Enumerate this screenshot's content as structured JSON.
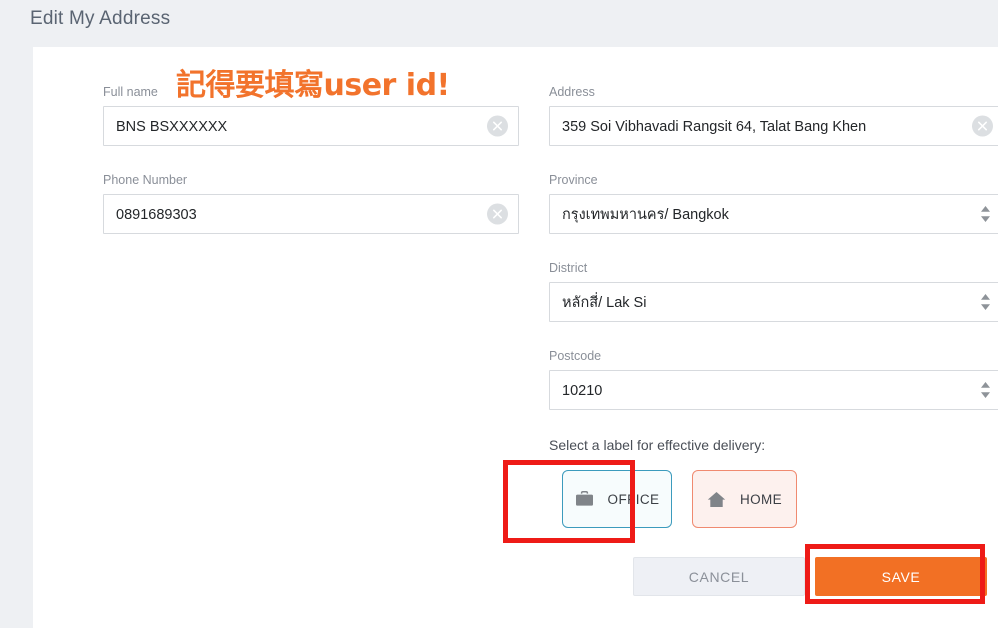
{
  "header": {
    "title": "Edit My Address"
  },
  "form": {
    "fields": [
      {
        "key": "fullname",
        "label": "Full name",
        "value": "BNS BSXXXXXX",
        "type": "text",
        "trailing_icon": "clear-icon"
      },
      {
        "key": "phone",
        "label": "Phone Number",
        "value": "0891689303",
        "type": "text",
        "trailing_icon": "clear-icon"
      },
      {
        "key": "address",
        "label": "Address",
        "value": "359 Soi Vibhavadi Rangsit 64, Talat Bang Khen",
        "type": "text",
        "trailing_icon": "clear-icon"
      },
      {
        "key": "province",
        "label": "Province",
        "value": "กรุงเทพมหานคร/ Bangkok",
        "type": "select",
        "trailing_icon": "updown-spinner-icon"
      },
      {
        "key": "district",
        "label": "District",
        "value": "หลักสี่/ Lak Si",
        "type": "select",
        "trailing_icon": "updown-spinner-icon"
      },
      {
        "key": "postcode",
        "label": "Postcode",
        "value": "10210",
        "type": "select",
        "trailing_icon": "updown-spinner-icon"
      }
    ]
  },
  "label_selector": {
    "hint": "Select a label for effective delivery:",
    "options": [
      {
        "key": "office",
        "label": "OFFICE",
        "icon": "briefcase-icon",
        "selected": true,
        "border_color": "#3c9bbd",
        "background_color": "#f7fcfd"
      },
      {
        "key": "home",
        "label": "HOME",
        "icon": "home-icon",
        "selected": false,
        "border_color": "#f08a70",
        "background_color": "#fdf1ee"
      }
    ]
  },
  "actions": {
    "cancel_label": "CANCEL",
    "save_label": "SAVE",
    "save_color": "#f27024",
    "cancel_color": "#eef0f5"
  },
  "annotations": {
    "note_text": "記得要填寫user id!",
    "note_color": "#f2732c",
    "highlight_color": "#ee1b17",
    "highlighted_elements": [
      "office-label-button",
      "save-button"
    ]
  },
  "theme": {
    "page_background": "#eef0f3",
    "card_background": "#ffffff",
    "title_color": "#5a6472",
    "field_label_color": "#8a8f98",
    "input_border_color": "#d7dade"
  }
}
